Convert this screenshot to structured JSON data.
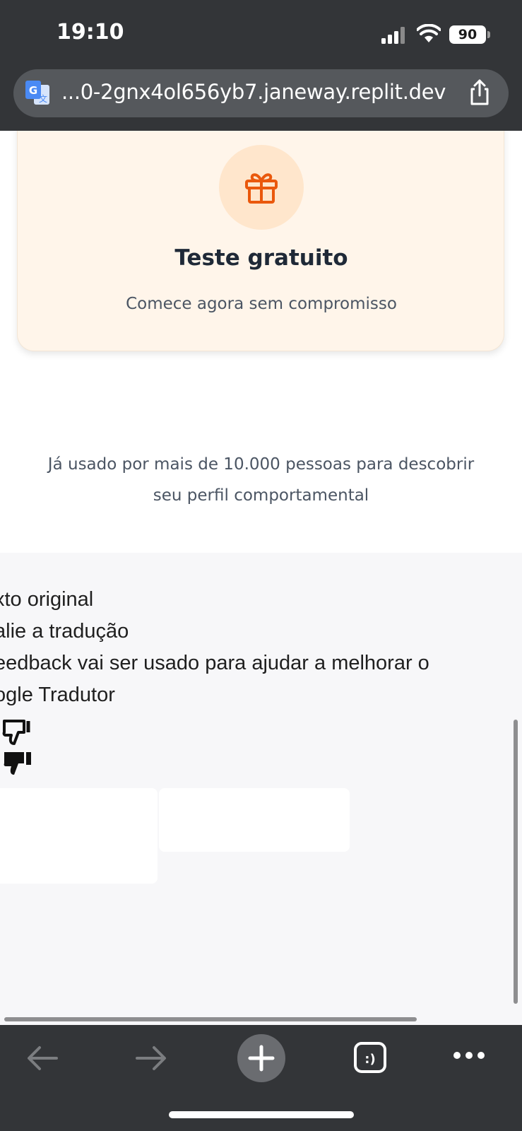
{
  "status_bar": {
    "time": "19:10",
    "battery": "90",
    "icons": [
      "signal-icon",
      "wifi-icon",
      "battery-icon"
    ]
  },
  "url_bar": {
    "url": "...0-2gnx4ol656yb7.janeway.replit.dev",
    "icons": [
      "translate-icon",
      "share-icon"
    ]
  },
  "card": {
    "icon": "gift-icon",
    "title": "Teste gratuito",
    "subtitle": "Comece agora sem compromisso"
  },
  "social_proof": {
    "line1": "Já usado por mais de 10.000 pessoas para descobrir",
    "line2": "seu perfil comportamental"
  },
  "translate_feedback": {
    "line1": "xto original",
    "line2": "alie a tradução",
    "line3": "eedback vai ser usado para ajudar a melhorar o",
    "line4": "ogle Tradutor",
    "icons": [
      "thumbs-down-outline-icon",
      "thumbs-down-filled-icon"
    ]
  },
  "toolbar": {
    "icons": [
      "back-arrow-icon",
      "forward-arrow-icon",
      "new-tab-plus-icon",
      "tabs-icon",
      "more-icon"
    ],
    "tabs_label": ":)"
  },
  "colors": {
    "chrome_bg": "#333538",
    "url_pill": "#55585c",
    "card_bg": "#fff5ea",
    "gift_circle": "#ffe6cc",
    "accent_orange": "#ea580c",
    "text_dark": "#1f2937",
    "text_muted": "#4b5563"
  }
}
